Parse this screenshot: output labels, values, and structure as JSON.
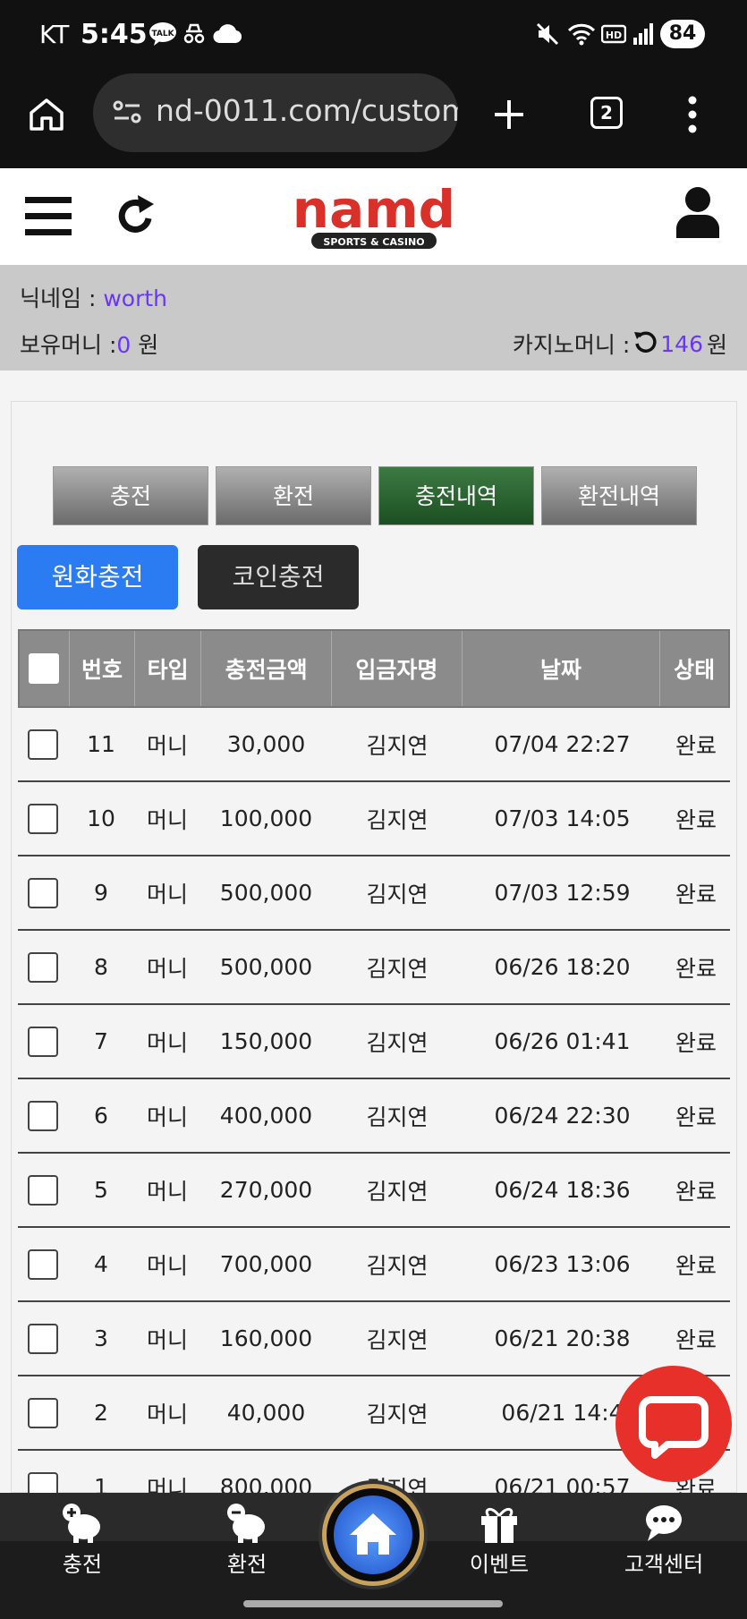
{
  "status_bar": {
    "carrier": "KT",
    "time": "5:45",
    "battery": "84"
  },
  "browser": {
    "url": "nd-0011.com/custom",
    "tab_count": "2"
  },
  "site": {
    "logo_text": "namd",
    "logo_sub": "SPORTS & CASINO"
  },
  "user": {
    "nick_label": "닉네임 :",
    "nick_value": "worth",
    "money_label": "보유머니 :",
    "money_value": "0",
    "money_unit": "원",
    "casino_label": "카지노머니 :",
    "casino_value": "146",
    "casino_unit": "원"
  },
  "tabs": [
    {
      "label": "충전"
    },
    {
      "label": "환전"
    },
    {
      "label": "충전내역"
    },
    {
      "label": "환전내역"
    }
  ],
  "subtabs": [
    {
      "label": "원화충전"
    },
    {
      "label": "코인충전"
    }
  ],
  "table": {
    "headers": [
      "번호",
      "타입",
      "충전금액",
      "입금자명",
      "날짜",
      "상태"
    ],
    "rows": [
      {
        "no": "11",
        "type": "머니",
        "amount": "30,000",
        "name": "김지연",
        "date": "07/04 22:27",
        "status": "완료"
      },
      {
        "no": "10",
        "type": "머니",
        "amount": "100,000",
        "name": "김지연",
        "date": "07/03 14:05",
        "status": "완료"
      },
      {
        "no": "9",
        "type": "머니",
        "amount": "500,000",
        "name": "김지연",
        "date": "07/03 12:59",
        "status": "완료"
      },
      {
        "no": "8",
        "type": "머니",
        "amount": "500,000",
        "name": "김지연",
        "date": "06/26 18:20",
        "status": "완료"
      },
      {
        "no": "7",
        "type": "머니",
        "amount": "150,000",
        "name": "김지연",
        "date": "06/26 01:41",
        "status": "완료"
      },
      {
        "no": "6",
        "type": "머니",
        "amount": "400,000",
        "name": "김지연",
        "date": "06/24 22:30",
        "status": "완료"
      },
      {
        "no": "5",
        "type": "머니",
        "amount": "270,000",
        "name": "김지연",
        "date": "06/24 18:36",
        "status": "완료"
      },
      {
        "no": "4",
        "type": "머니",
        "amount": "700,000",
        "name": "김지연",
        "date": "06/23 13:06",
        "status": "완료"
      },
      {
        "no": "3",
        "type": "머니",
        "amount": "160,000",
        "name": "김지연",
        "date": "06/21 20:38",
        "status": "완료"
      },
      {
        "no": "2",
        "type": "머니",
        "amount": "40,000",
        "name": "김지연",
        "date": "06/21 14:4",
        "status": ""
      },
      {
        "no": "1",
        "type": "머니",
        "amount": "800,000",
        "name": "김지연",
        "date": "06/21 00:57",
        "status": "완료"
      }
    ]
  },
  "bottom_nav": [
    {
      "label": "충전"
    },
    {
      "label": "환전"
    },
    {
      "label": "이벤트"
    },
    {
      "label": "고객센터"
    }
  ],
  "colors": {
    "accent_purple": "#6a35ff",
    "active_tab": "#2a5f30",
    "primary_blue": "#2b7cf3",
    "chat_red": "#e8302a",
    "logo_red": "#d9302a"
  }
}
